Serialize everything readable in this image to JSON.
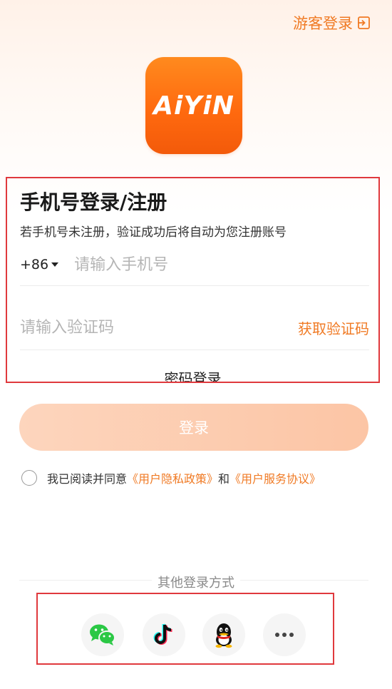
{
  "header": {
    "guest_login_label": "游客登录"
  },
  "logo": {
    "text": "AiYiN",
    "brand_color": "#ff6a0f"
  },
  "form": {
    "title": "手机号登录/注册",
    "subtitle": "若手机号未注册，验证成功后将自动为您注册账号",
    "country_code": "+86",
    "phone_placeholder": "请输入手机号",
    "phone_value": "",
    "code_placeholder": "请输入验证码",
    "code_value": "",
    "get_code_label": "获取验证码",
    "password_login_label": "密码登录"
  },
  "login_button": {
    "label": "登录"
  },
  "agreement": {
    "prefix": "我已阅读并同意",
    "privacy_link": "《用户隐私政策》",
    "and": "和",
    "service_link": "《用户服务协议》",
    "checked": false
  },
  "other_login": {
    "label": "其他登录方式",
    "methods": [
      "wechat-icon",
      "tiktok-icon",
      "qq-icon",
      "more-icon"
    ]
  },
  "colors": {
    "accent": "#f07a24",
    "highlight_border": "#e0393d"
  }
}
